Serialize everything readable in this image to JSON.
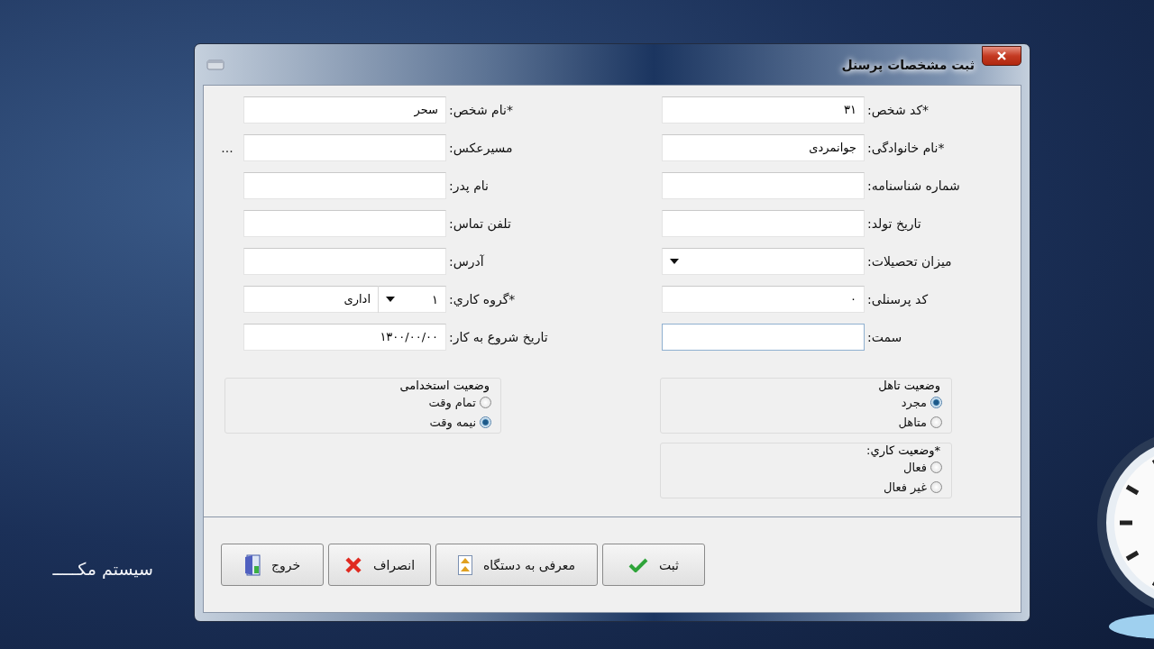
{
  "desktop": {
    "caption": "سیستم مکـــــ"
  },
  "window": {
    "title": "ثبت مشخصات پرسنل"
  },
  "form": {
    "right_fields": [
      {
        "kind": "text",
        "label": "*کد شخص:",
        "value": "۳۱",
        "focused": false
      },
      {
        "kind": "text",
        "label": "*نام خانوادگی:",
        "value": "جوانمردی",
        "focused": false
      },
      {
        "kind": "text",
        "label": "شماره شناسنامه:",
        "focused": false
      },
      {
        "kind": "text",
        "label": "تاریخ تولد:",
        "focused": false
      },
      {
        "kind": "combo",
        "label": "میزان تحصیلات:",
        "focused": false
      },
      {
        "kind": "text",
        "label": "کد پرسنلی:",
        "value": "۰",
        "focused": false
      },
      {
        "kind": "text",
        "label": "سمت:",
        "focused": true
      }
    ],
    "left_fields": [
      {
        "kind": "text",
        "label": "*نام شخص:",
        "value": "سحر"
      },
      {
        "kind": "browse",
        "label": "مسیرعکس:",
        "browse": "..."
      },
      {
        "kind": "text",
        "label": "نام  پدر:"
      },
      {
        "kind": "text",
        "label": "تلفن تماس:"
      },
      {
        "kind": "text",
        "label": "آدرس:"
      },
      {
        "kind": "group-combo",
        "label": "*گروه کاري:",
        "code": "۱",
        "value": "اداری"
      },
      {
        "kind": "text",
        "label": "تاریخ شروع به کار:",
        "value": "۱۳۰۰/۰۰/۰۰"
      }
    ],
    "marital_status": {
      "legend": "وضعیت تاهل",
      "options": [
        {
          "label": "مجرد",
          "selected": true
        },
        {
          "label": "متاهل",
          "selected": false
        }
      ]
    },
    "work_status": {
      "legend": "*وضعیت کاري:",
      "options": [
        {
          "label": "فعال",
          "selected": false
        },
        {
          "label": "غیر فعال",
          "selected": false
        }
      ]
    },
    "employment_status": {
      "legend": "وضعیت استخدامی",
      "options": [
        {
          "label": "تمام وقت",
          "selected": false
        },
        {
          "label": "نیمه وقت",
          "selected": true
        }
      ]
    }
  },
  "buttons": [
    {
      "kind": "save",
      "label": "ثبت"
    },
    {
      "kind": "device",
      "label": "معرفی به دستگاه"
    },
    {
      "kind": "cancel",
      "label": "انصراف"
    },
    {
      "kind": "exit",
      "label": "خروج"
    }
  ]
}
